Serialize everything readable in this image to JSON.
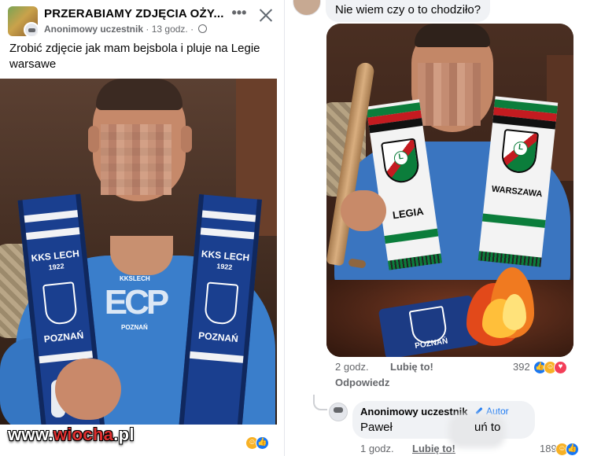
{
  "post": {
    "group_name": "PRZERABIAMY ZDJĘCIA  OŻY...",
    "author": "Anonimowy uczestnik",
    "time": "13 godz.",
    "separator": "·",
    "more_label": "•••",
    "text": "Zrobić zdjęcie jak mam bejsbola i pluje na Legie warsawe"
  },
  "left_photo": {
    "scarf_text_top": "KKS LECH",
    "scarf_year": "1922",
    "scarf_text_bottom": "POZNAŃ",
    "shirt_logo_small": "KKSLECH",
    "shirt_logo": "ECP",
    "shirt_logo_bottom": "POZNAŃ"
  },
  "watermark": {
    "prefix": "www.",
    "middle": "wiocha",
    "suffix": ".pl"
  },
  "comment_top": {
    "text": "Nie wiem czy o to chodziło?"
  },
  "right_photo": {
    "scarf_left_label": "LEGIA",
    "scarf_right_label": "WARSZAWA",
    "burning_scarf_label": "POZNAŃ"
  },
  "comment_meta": {
    "time": "2 godz.",
    "like_label": "Lubię to!",
    "reaction_count": "392",
    "reply_label": "Odpowiedz"
  },
  "reply": {
    "author": "Anonimowy uczestnik",
    "badge": "Autor",
    "text_start": "Paweł",
    "text_end": "uń to",
    "time": "1 godz.",
    "like_label": "Lubię to!",
    "reaction_count": "189"
  },
  "colors": {
    "facebook_blue": "#1877f2",
    "bubble_gray": "#f0f2f5",
    "meta_gray": "#65676b",
    "lech_blue": "#1a3f8f",
    "legia_green": "#0b7d3b",
    "legia_red": "#c41b20",
    "watermark_red": "#e02f2f"
  },
  "icons": {
    "close": "close-icon",
    "globe": "globe-icon",
    "pencil": "pencil-icon",
    "like_reaction": "like-reaction-icon",
    "haha_reaction": "haha-reaction-icon",
    "love_reaction": "love-reaction-icon"
  }
}
